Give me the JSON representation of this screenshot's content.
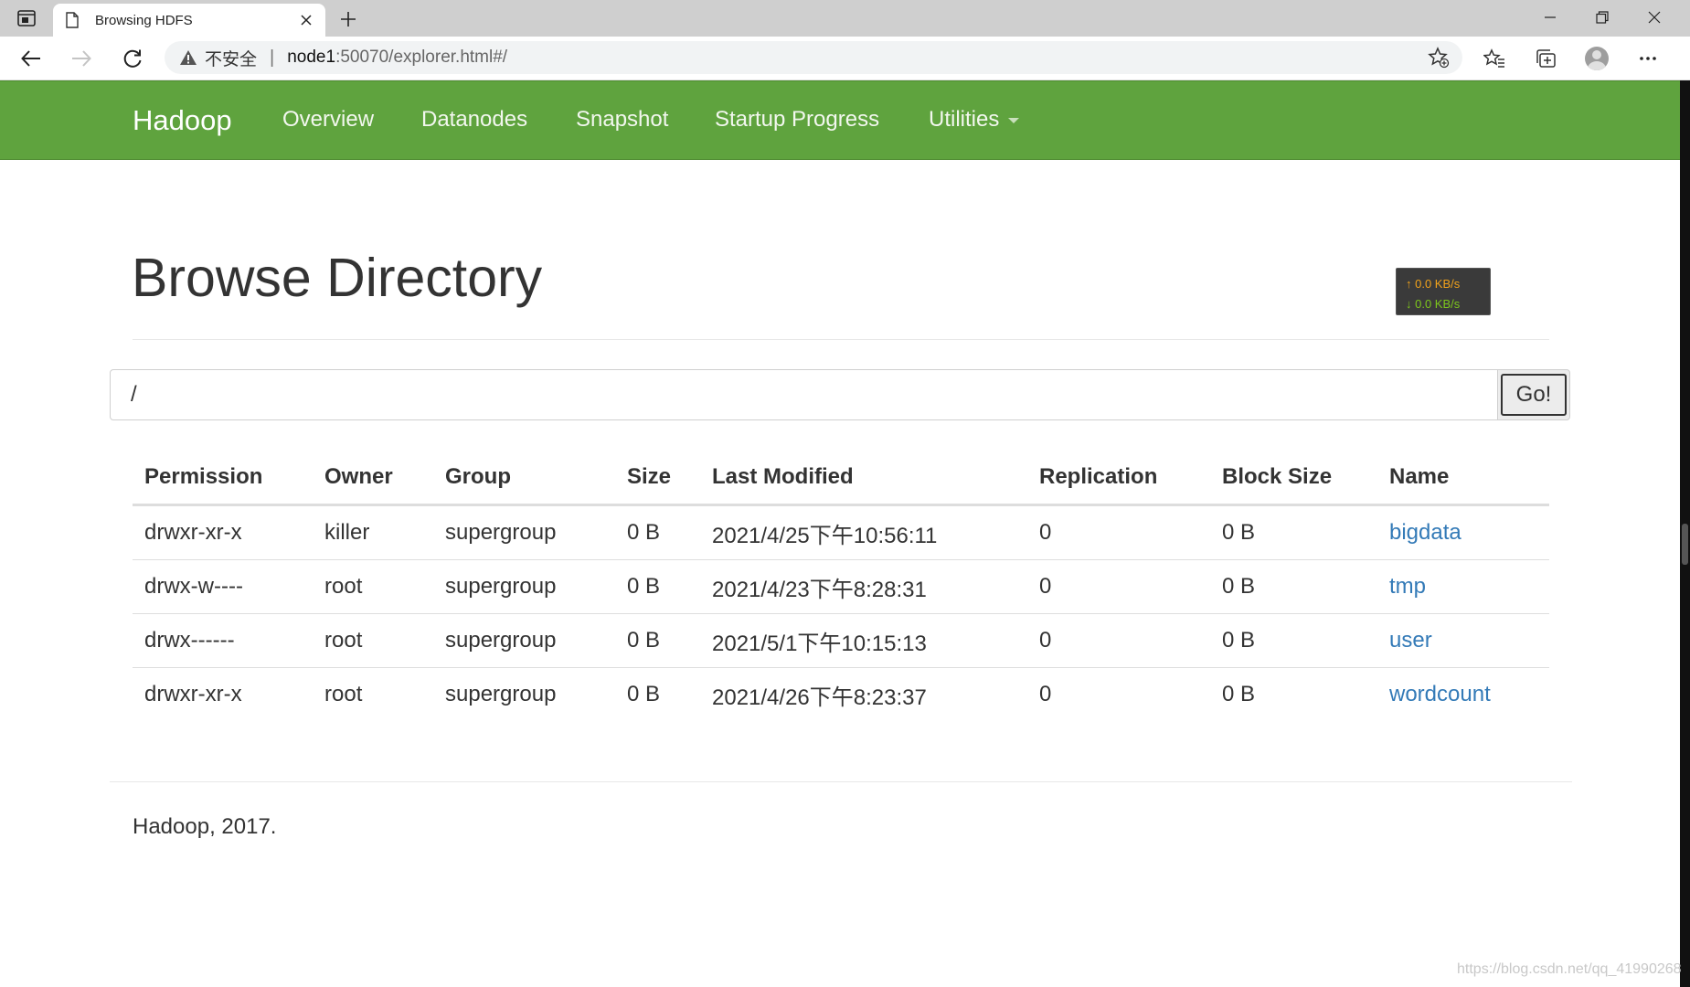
{
  "browser": {
    "tab_title": "Browsing HDFS",
    "insecure_label": "不安全",
    "url_host": "node1",
    "url_rest": ":50070/explorer.html#/"
  },
  "navbar": {
    "brand": "Hadoop",
    "links": [
      "Overview",
      "Datanodes",
      "Snapshot",
      "Startup Progress",
      "Utilities"
    ]
  },
  "page": {
    "title": "Browse Directory",
    "path_value": "/",
    "go_label": "Go!"
  },
  "speed_widget": {
    "upload": "↑ 0.0 KB/s",
    "download": "↓ 0.0 KB/s"
  },
  "table": {
    "headers": [
      "Permission",
      "Owner",
      "Group",
      "Size",
      "Last Modified",
      "Replication",
      "Block Size",
      "Name"
    ],
    "rows": [
      [
        "drwxr-xr-x",
        "killer",
        "supergroup",
        "0 B",
        "2021/4/25下午10:56:11",
        "0",
        "0 B",
        "bigdata"
      ],
      [
        "drwx-w----",
        "root",
        "supergroup",
        "0 B",
        "2021/4/23下午8:28:31",
        "0",
        "0 B",
        "tmp"
      ],
      [
        "drwx------",
        "root",
        "supergroup",
        "0 B",
        "2021/5/1下午10:15:13",
        "0",
        "0 B",
        "user"
      ],
      [
        "drwxr-xr-x",
        "root",
        "supergroup",
        "0 B",
        "2021/4/26下午8:23:37",
        "0",
        "0 B",
        "wordcount"
      ]
    ]
  },
  "footer": {
    "text": "Hadoop, 2017."
  },
  "watermark": "https://blog.csdn.net/qq_41990268"
}
